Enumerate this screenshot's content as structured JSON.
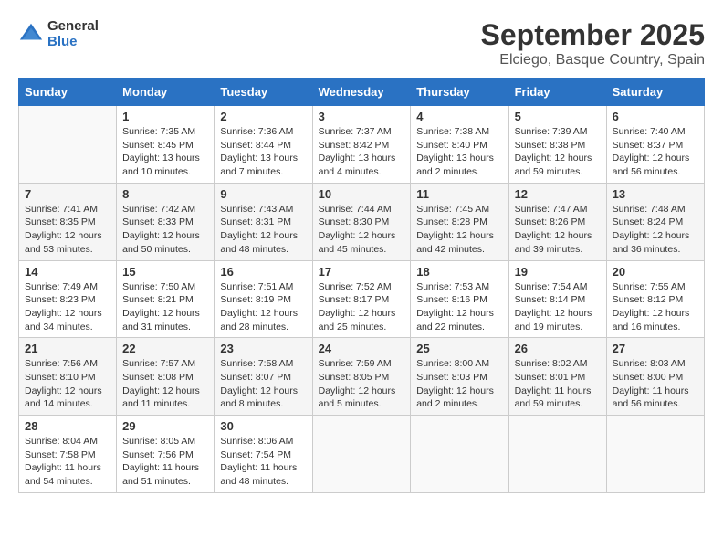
{
  "header": {
    "logo_line1": "General",
    "logo_line2": "Blue",
    "title": "September 2025",
    "subtitle": "Elciego, Basque Country, Spain"
  },
  "columns": [
    "Sunday",
    "Monday",
    "Tuesday",
    "Wednesday",
    "Thursday",
    "Friday",
    "Saturday"
  ],
  "weeks": [
    [
      {
        "day": "",
        "sunrise": "",
        "sunset": "",
        "daylight": ""
      },
      {
        "day": "1",
        "sunrise": "Sunrise: 7:35 AM",
        "sunset": "Sunset: 8:45 PM",
        "daylight": "Daylight: 13 hours and 10 minutes."
      },
      {
        "day": "2",
        "sunrise": "Sunrise: 7:36 AM",
        "sunset": "Sunset: 8:44 PM",
        "daylight": "Daylight: 13 hours and 7 minutes."
      },
      {
        "day": "3",
        "sunrise": "Sunrise: 7:37 AM",
        "sunset": "Sunset: 8:42 PM",
        "daylight": "Daylight: 13 hours and 4 minutes."
      },
      {
        "day": "4",
        "sunrise": "Sunrise: 7:38 AM",
        "sunset": "Sunset: 8:40 PM",
        "daylight": "Daylight: 13 hours and 2 minutes."
      },
      {
        "day": "5",
        "sunrise": "Sunrise: 7:39 AM",
        "sunset": "Sunset: 8:38 PM",
        "daylight": "Daylight: 12 hours and 59 minutes."
      },
      {
        "day": "6",
        "sunrise": "Sunrise: 7:40 AM",
        "sunset": "Sunset: 8:37 PM",
        "daylight": "Daylight: 12 hours and 56 minutes."
      }
    ],
    [
      {
        "day": "7",
        "sunrise": "Sunrise: 7:41 AM",
        "sunset": "Sunset: 8:35 PM",
        "daylight": "Daylight: 12 hours and 53 minutes."
      },
      {
        "day": "8",
        "sunrise": "Sunrise: 7:42 AM",
        "sunset": "Sunset: 8:33 PM",
        "daylight": "Daylight: 12 hours and 50 minutes."
      },
      {
        "day": "9",
        "sunrise": "Sunrise: 7:43 AM",
        "sunset": "Sunset: 8:31 PM",
        "daylight": "Daylight: 12 hours and 48 minutes."
      },
      {
        "day": "10",
        "sunrise": "Sunrise: 7:44 AM",
        "sunset": "Sunset: 8:30 PM",
        "daylight": "Daylight: 12 hours and 45 minutes."
      },
      {
        "day": "11",
        "sunrise": "Sunrise: 7:45 AM",
        "sunset": "Sunset: 8:28 PM",
        "daylight": "Daylight: 12 hours and 42 minutes."
      },
      {
        "day": "12",
        "sunrise": "Sunrise: 7:47 AM",
        "sunset": "Sunset: 8:26 PM",
        "daylight": "Daylight: 12 hours and 39 minutes."
      },
      {
        "day": "13",
        "sunrise": "Sunrise: 7:48 AM",
        "sunset": "Sunset: 8:24 PM",
        "daylight": "Daylight: 12 hours and 36 minutes."
      }
    ],
    [
      {
        "day": "14",
        "sunrise": "Sunrise: 7:49 AM",
        "sunset": "Sunset: 8:23 PM",
        "daylight": "Daylight: 12 hours and 34 minutes."
      },
      {
        "day": "15",
        "sunrise": "Sunrise: 7:50 AM",
        "sunset": "Sunset: 8:21 PM",
        "daylight": "Daylight: 12 hours and 31 minutes."
      },
      {
        "day": "16",
        "sunrise": "Sunrise: 7:51 AM",
        "sunset": "Sunset: 8:19 PM",
        "daylight": "Daylight: 12 hours and 28 minutes."
      },
      {
        "day": "17",
        "sunrise": "Sunrise: 7:52 AM",
        "sunset": "Sunset: 8:17 PM",
        "daylight": "Daylight: 12 hours and 25 minutes."
      },
      {
        "day": "18",
        "sunrise": "Sunrise: 7:53 AM",
        "sunset": "Sunset: 8:16 PM",
        "daylight": "Daylight: 12 hours and 22 minutes."
      },
      {
        "day": "19",
        "sunrise": "Sunrise: 7:54 AM",
        "sunset": "Sunset: 8:14 PM",
        "daylight": "Daylight: 12 hours and 19 minutes."
      },
      {
        "day": "20",
        "sunrise": "Sunrise: 7:55 AM",
        "sunset": "Sunset: 8:12 PM",
        "daylight": "Daylight: 12 hours and 16 minutes."
      }
    ],
    [
      {
        "day": "21",
        "sunrise": "Sunrise: 7:56 AM",
        "sunset": "Sunset: 8:10 PM",
        "daylight": "Daylight: 12 hours and 14 minutes."
      },
      {
        "day": "22",
        "sunrise": "Sunrise: 7:57 AM",
        "sunset": "Sunset: 8:08 PM",
        "daylight": "Daylight: 12 hours and 11 minutes."
      },
      {
        "day": "23",
        "sunrise": "Sunrise: 7:58 AM",
        "sunset": "Sunset: 8:07 PM",
        "daylight": "Daylight: 12 hours and 8 minutes."
      },
      {
        "day": "24",
        "sunrise": "Sunrise: 7:59 AM",
        "sunset": "Sunset: 8:05 PM",
        "daylight": "Daylight: 12 hours and 5 minutes."
      },
      {
        "day": "25",
        "sunrise": "Sunrise: 8:00 AM",
        "sunset": "Sunset: 8:03 PM",
        "daylight": "Daylight: 12 hours and 2 minutes."
      },
      {
        "day": "26",
        "sunrise": "Sunrise: 8:02 AM",
        "sunset": "Sunset: 8:01 PM",
        "daylight": "Daylight: 11 hours and 59 minutes."
      },
      {
        "day": "27",
        "sunrise": "Sunrise: 8:03 AM",
        "sunset": "Sunset: 8:00 PM",
        "daylight": "Daylight: 11 hours and 56 minutes."
      }
    ],
    [
      {
        "day": "28",
        "sunrise": "Sunrise: 8:04 AM",
        "sunset": "Sunset: 7:58 PM",
        "daylight": "Daylight: 11 hours and 54 minutes."
      },
      {
        "day": "29",
        "sunrise": "Sunrise: 8:05 AM",
        "sunset": "Sunset: 7:56 PM",
        "daylight": "Daylight: 11 hours and 51 minutes."
      },
      {
        "day": "30",
        "sunrise": "Sunrise: 8:06 AM",
        "sunset": "Sunset: 7:54 PM",
        "daylight": "Daylight: 11 hours and 48 minutes."
      },
      {
        "day": "",
        "sunrise": "",
        "sunset": "",
        "daylight": ""
      },
      {
        "day": "",
        "sunrise": "",
        "sunset": "",
        "daylight": ""
      },
      {
        "day": "",
        "sunrise": "",
        "sunset": "",
        "daylight": ""
      },
      {
        "day": "",
        "sunrise": "",
        "sunset": "",
        "daylight": ""
      }
    ]
  ]
}
